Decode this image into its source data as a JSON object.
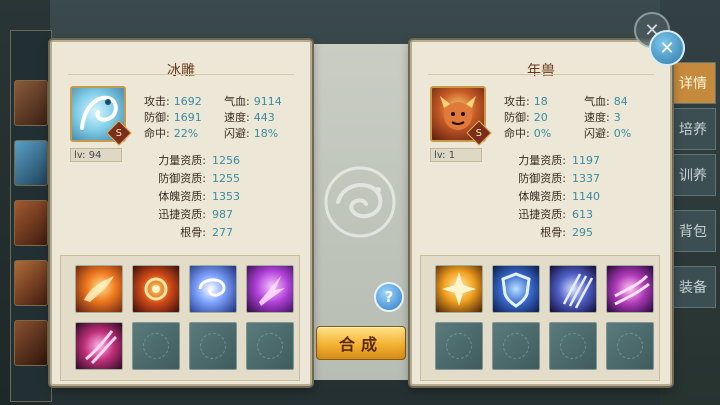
{
  "background": {
    "side_tabs": [
      "详情",
      "培养",
      "训养",
      "背包",
      "装备"
    ],
    "bottom_text": ""
  },
  "left_pet": {
    "name": "冰雕",
    "grade": "S",
    "level": "lv: 94",
    "stats": [
      {
        "k": "攻击:",
        "v": "1692"
      },
      {
        "k": "气血:",
        "v": "9114"
      },
      {
        "k": "防御:",
        "v": "1691"
      },
      {
        "k": "速度:",
        "v": "443"
      },
      {
        "k": "命中:",
        "v": "22%"
      },
      {
        "k": "闪避:",
        "v": "18%"
      }
    ],
    "aptitudes": [
      {
        "k": "力量资质:",
        "v": "1256"
      },
      {
        "k": "防御资质:",
        "v": "1255"
      },
      {
        "k": "体魄资质:",
        "v": "1353"
      },
      {
        "k": "迅捷资质:",
        "v": "987"
      },
      {
        "k": "根骨:",
        "v": "277"
      }
    ],
    "skills": [
      "fire-phoenix-skill-icon",
      "fire-orb-skill-icon",
      "wind-vortex-skill-icon",
      "purple-strike-skill-icon",
      "pink-claw-skill-icon"
    ]
  },
  "right_pet": {
    "name": "年兽",
    "grade": "S",
    "level": "lv: 1",
    "stats": [
      {
        "k": "攻击:",
        "v": "18"
      },
      {
        "k": "气血:",
        "v": "84"
      },
      {
        "k": "防御:",
        "v": "20"
      },
      {
        "k": "速度:",
        "v": "3"
      },
      {
        "k": "命中:",
        "v": "0%"
      },
      {
        "k": "闪避:",
        "v": "0%"
      }
    ],
    "aptitudes": [
      {
        "k": "力量资质:",
        "v": "1197"
      },
      {
        "k": "防御资质:",
        "v": "1337"
      },
      {
        "k": "体魄资质:",
        "v": "1140"
      },
      {
        "k": "迅捷资质:",
        "v": "613"
      },
      {
        "k": "根骨:",
        "v": "295"
      }
    ],
    "skills": [
      "golden-burst-skill-icon",
      "blue-shield-skill-icon",
      "blue-claw-skill-icon",
      "purple-slash-skill-icon"
    ]
  },
  "middle": {
    "help": "?",
    "merge_label": "合成"
  },
  "colors": {
    "value": "#3a8ba0",
    "label": "#3a2b22",
    "title": "#6a3a1c",
    "merge": "#f4b232"
  }
}
